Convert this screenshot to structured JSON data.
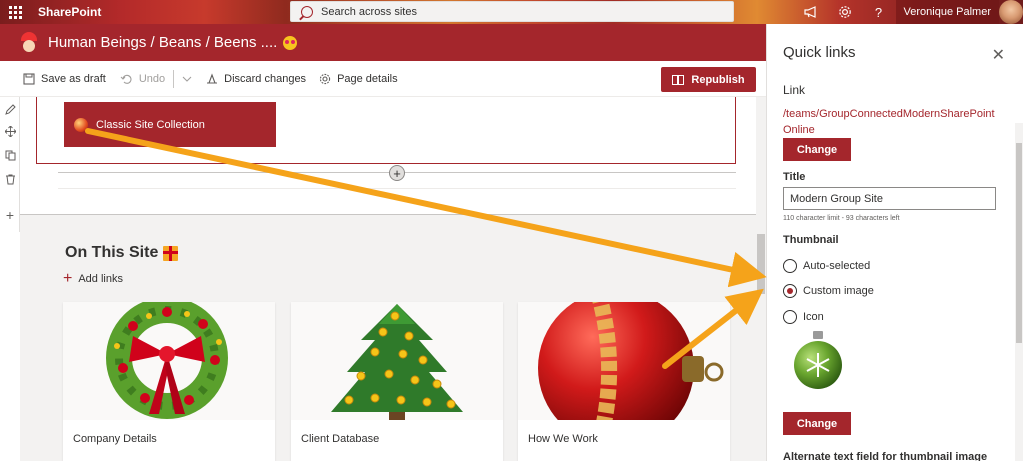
{
  "suite": {
    "brand": "SharePoint",
    "search_placeholder": "Search across sites",
    "user_name": "Veronique Palmer",
    "icons": [
      "waffle-icon",
      "megaphone-icon",
      "gear-icon",
      "help-icon"
    ]
  },
  "site": {
    "title": "Human Beings / Beans / Beens ...."
  },
  "commandbar": {
    "save_draft": "Save as draft",
    "undo": "Undo",
    "discard": "Discard changes",
    "page_details": "Page details",
    "republish": "Republish"
  },
  "canvas": {
    "classic_button": "Classic Site Collection",
    "section_title": "On This Site",
    "add_links": "Add links",
    "cards": [
      {
        "label": "Company Details",
        "image": "wreath"
      },
      {
        "label": "Client Database",
        "image": "christmas-tree"
      },
      {
        "label": "How We Work",
        "image": "red-bauble"
      }
    ]
  },
  "panel": {
    "title": "Quick links",
    "link_label": "Link",
    "link_url": "/teams/GroupConnectedModernSharePointOnline",
    "change_label": "Change",
    "title_label": "Title",
    "title_value": "Modern Group Site",
    "char_hint": "110 character limit - 93 characters left",
    "thumbnail_label": "Thumbnail",
    "radios": [
      {
        "label": "Auto-selected",
        "selected": false
      },
      {
        "label": "Custom image",
        "selected": true
      },
      {
        "label": "Icon",
        "selected": false
      }
    ],
    "change_label_2": "Change",
    "alt_text_label": "Alternate text field for thumbnail image"
  },
  "colors": {
    "accent": "#a4262c",
    "annotation_arrow": "#f5a31a"
  }
}
